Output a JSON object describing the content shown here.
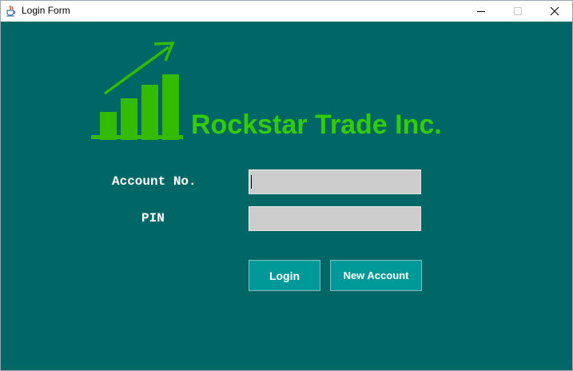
{
  "window": {
    "title": "Login Form",
    "app_icon": "java-cup-icon",
    "controls": {
      "minimize_icon": "minimize-icon",
      "maximize_icon": "maximize-icon",
      "close_icon": "close-icon"
    }
  },
  "brand": {
    "name": "Rockstar Trade Inc.",
    "logo_icon": "growth-chart-icon",
    "color": "#33cc00"
  },
  "form": {
    "account_label": "Account No.",
    "account_value": "",
    "pin_label": "PIN",
    "pin_value": ""
  },
  "buttons": {
    "login_label": "Login",
    "new_account_label": "New Account"
  },
  "colors": {
    "background": "#006666",
    "button": "#009999",
    "field": "#cccccc",
    "label_text": "#ffffff"
  }
}
